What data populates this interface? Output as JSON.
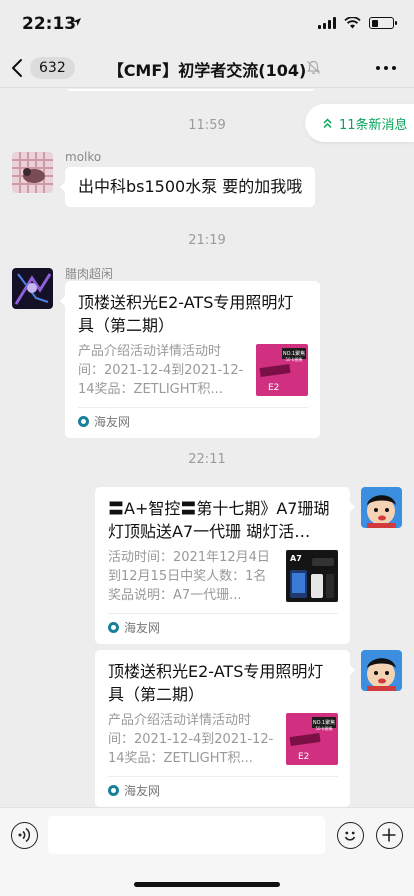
{
  "status": {
    "time": "22:13",
    "battery_level": 0.3
  },
  "nav": {
    "unread_count": "632",
    "title": "【CMF】初学者交流(104)",
    "muted": true
  },
  "new_messages_pill": "11条新消息",
  "messages": [
    {
      "type": "time",
      "text": "11:59"
    },
    {
      "type": "text",
      "side": "left",
      "sender": "molko",
      "text": "出中科bs1500水泵 要的加我哦"
    },
    {
      "type": "time",
      "text": "21:19"
    },
    {
      "type": "card",
      "side": "left",
      "sender": "腊肉超闲",
      "title": "顶楼送积光E2-ATS专用照明灯具（第二期）",
      "desc": "产品介绍活动详情活动时间：2021-12-4到2021-12-14奖品：ZETLIGHT积...",
      "source": "海友网"
    },
    {
      "type": "time",
      "text": "22:11"
    },
    {
      "type": "card",
      "side": "right",
      "title": "〓A+智控〓第十七期》A7珊瑚灯顶贴送A7一代珊 瑚灯活…",
      "desc": "活动时间：2021年12月4日到12月15日中奖人数：1名奖品说明：A7一代珊...",
      "source": "海友网"
    },
    {
      "type": "card",
      "side": "right",
      "title": "顶楼送积光E2-ATS专用照明灯具（第二期）",
      "desc": "产品介绍活动详情活动时间：2021-12-4到2021-12-14奖品：ZETLIGHT积...",
      "source": "海友网"
    }
  ],
  "thumb_text": {
    "e2_badge": "NO.1聚焦",
    "e2_badge2": "50卡圈捲",
    "e2_model": "E2",
    "a7_model": "A7"
  },
  "colors": {
    "accent_green": "#07a45a",
    "background": "#ededed"
  }
}
